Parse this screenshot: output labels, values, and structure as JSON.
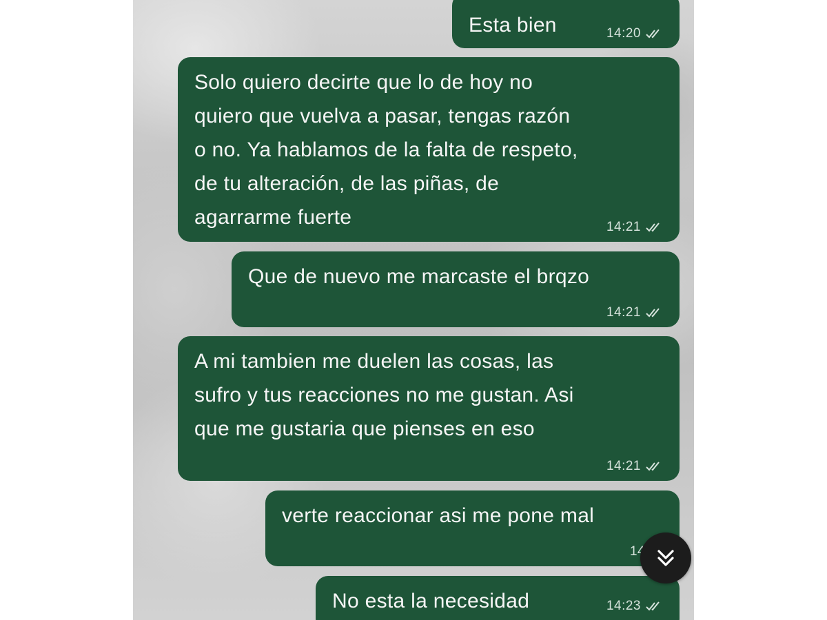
{
  "colors": {
    "bubble_background": "#1e5538",
    "bubble_text": "#f5f5f5",
    "timestamp_text": "#d6e3dc",
    "scroll_button_background": "#1c1c1c"
  },
  "messages": [
    {
      "text": "Esta bien",
      "time": "14:20",
      "status_icon": "double-check-icon"
    },
    {
      "text": "Solo quiero decirte que lo de hoy no\nquiero que vuelva a pasar, tengas razón\no no. Ya hablamos de la falta de respeto,\nde tu alteración, de las piñas, de\nagarrarme fuerte",
      "time": "14:21",
      "status_icon": "double-check-icon"
    },
    {
      "text": "Que de nuevo me marcaste el brqzo",
      "time": "14:21",
      "status_icon": "double-check-icon"
    },
    {
      "text": "A mi tambien me duelen las cosas, las\nsufro y tus reacciones no me gustan. Asi\nque me gustaria que pienses en eso",
      "time": "14:21",
      "status_icon": "double-check-icon"
    },
    {
      "text": "verte reaccionar asi me pone mal",
      "time": "14:23",
      "status_icon": "double-check-icon"
    },
    {
      "text": "No esta la necesidad",
      "time": "14:23",
      "status_icon": "double-check-icon"
    }
  ],
  "scroll_button": {
    "icon": "double-chevron-down-icon"
  }
}
